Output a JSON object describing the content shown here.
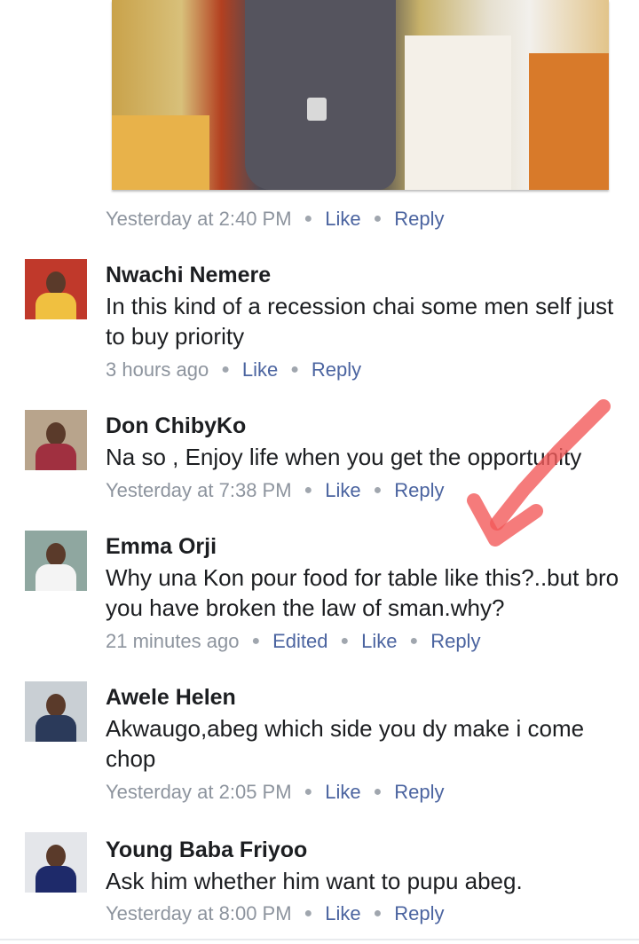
{
  "actions": {
    "like": "Like",
    "reply": "Reply",
    "edited": "Edited"
  },
  "top_post": {
    "timestamp": "Yesterday at 2:40 PM"
  },
  "comments": [
    {
      "name": "Nwachi Nemere",
      "text": "In this kind of a recession chai some men self just to buy priority",
      "timestamp": "3 hours ago"
    },
    {
      "name": "Don ChibyKo",
      "text": "Na so , Enjoy life when you get the opportunity",
      "timestamp": "Yesterday at 7:38 PM"
    },
    {
      "name": "Emma Orji",
      "text": "Why una Kon pour food for table like this?..but bro you have broken the law of sman.why?",
      "timestamp": "21 minutes ago"
    },
    {
      "name": "Awele Helen",
      "text": "Akwaugo,abeg which side you dy make i come chop",
      "timestamp": "Yesterday at 2:05 PM"
    },
    {
      "name": "Young Baba Friyoo",
      "text": "Ask him whether him want to pupu abeg.",
      "timestamp": "Yesterday at 8:00 PM"
    }
  ],
  "colors": {
    "link": "#4b64a0",
    "meta": "#8d949e",
    "annotation_arrow": "#f25a5a"
  }
}
